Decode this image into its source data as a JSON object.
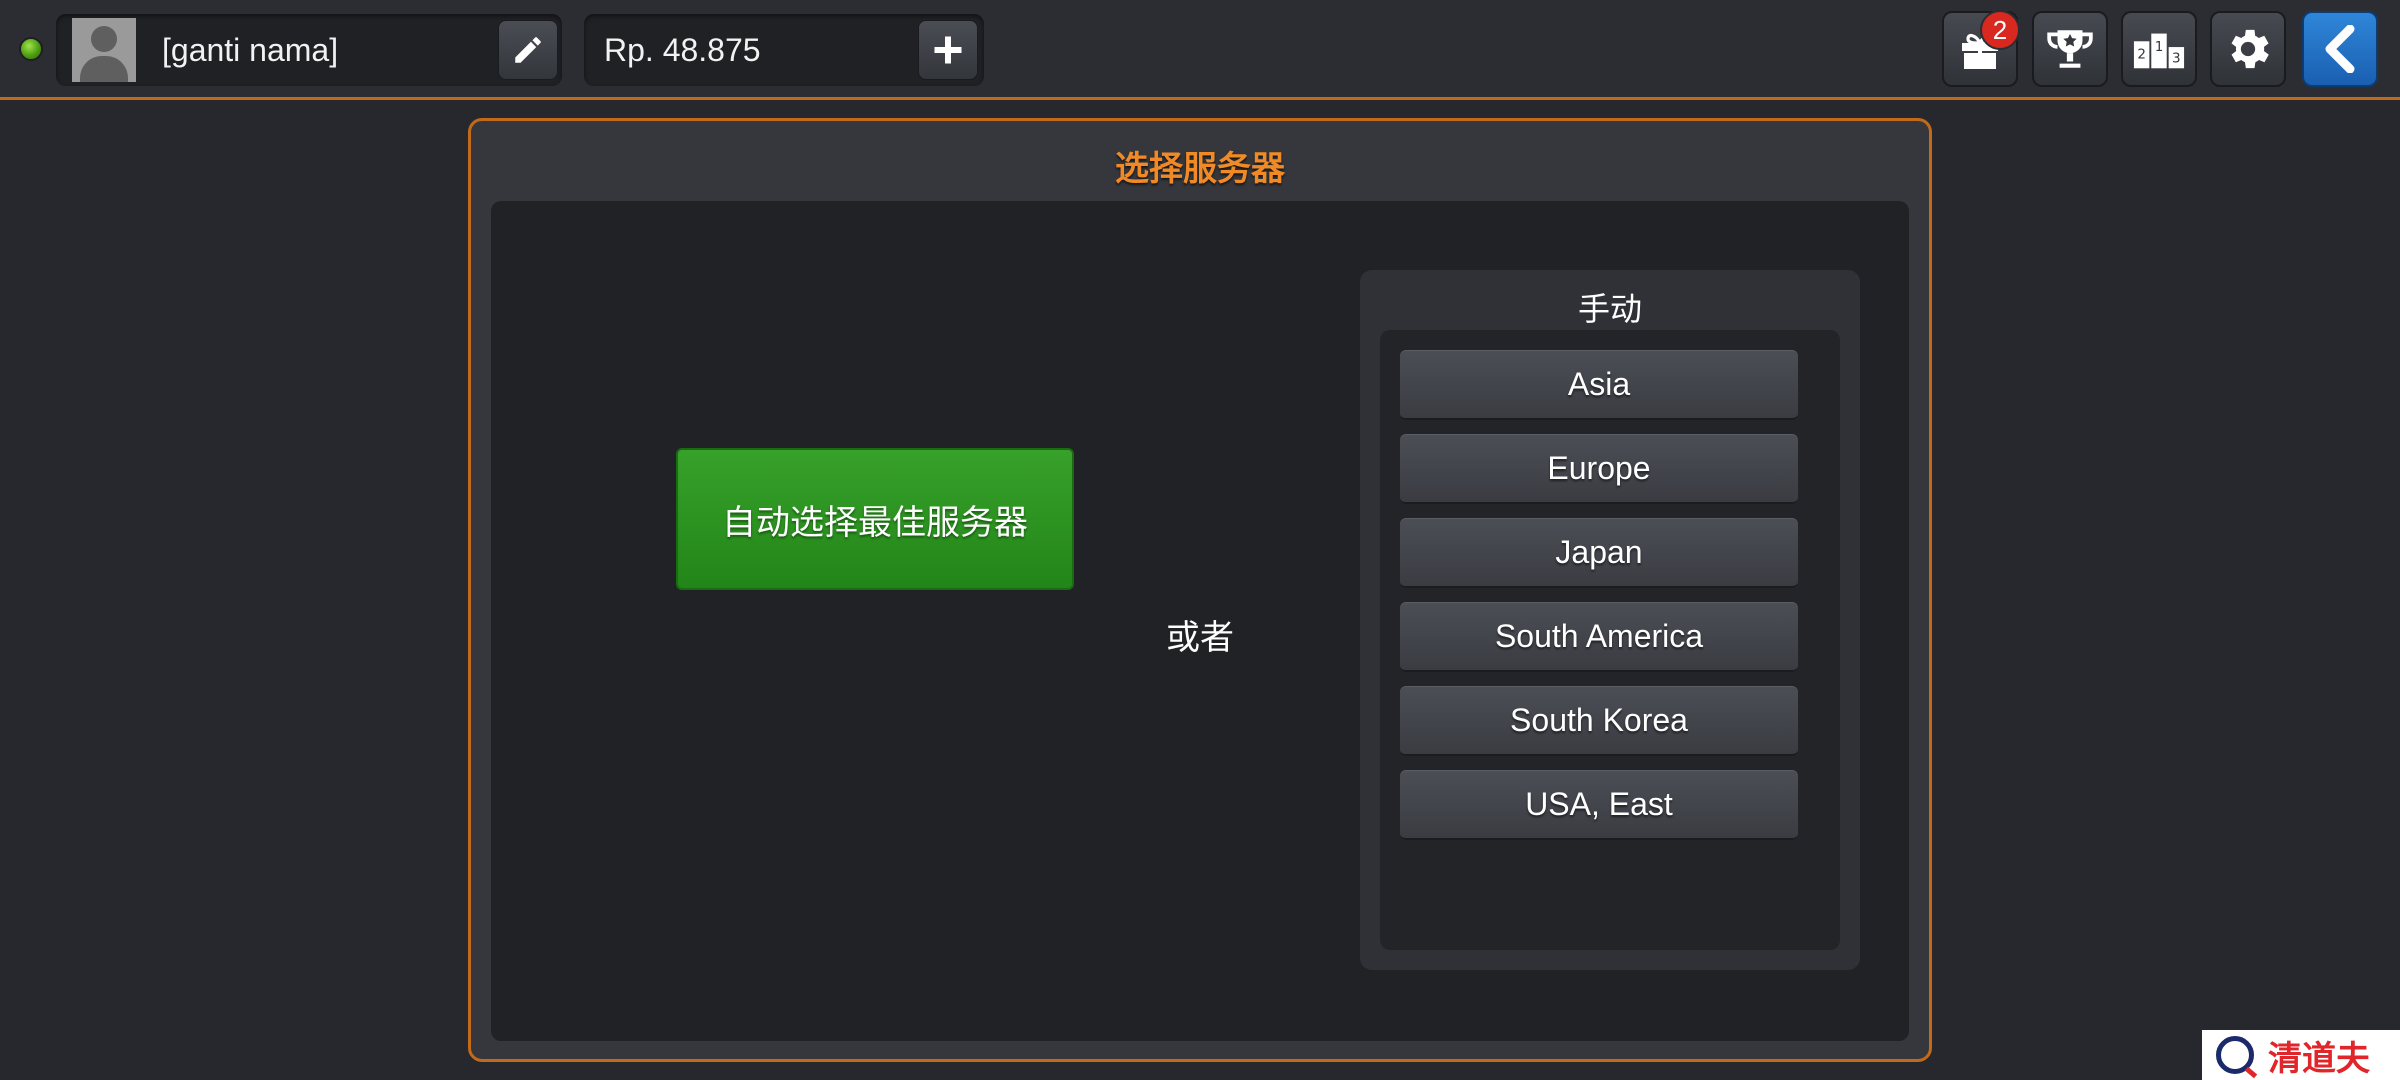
{
  "topbar": {
    "player_name": "[ganti nama]",
    "money": "Rp. 48.875",
    "gift_badge_count": "2",
    "status_color": "#5fb21a"
  },
  "dialog": {
    "title": "选择服务器",
    "auto_button_label": "自动选择最佳服务器",
    "or_label": "或者",
    "manual_title": "手动",
    "servers": [
      "Asia",
      "Europe",
      "Japan",
      "South America",
      "South Korea",
      "USA, East"
    ]
  },
  "watermark": {
    "text": "清道夫"
  },
  "theme": {
    "accent": "#f08a26",
    "border_accent": "#c06a1a",
    "auto_button_green": "#2e9322",
    "back_button_blue": "#2478cc",
    "badge_red": "#d8281f"
  },
  "icons": [
    "pencil-icon",
    "plus-icon",
    "gift-icon",
    "trophy-icon",
    "podium-icon",
    "gear-icon",
    "back-arrow-icon"
  ]
}
